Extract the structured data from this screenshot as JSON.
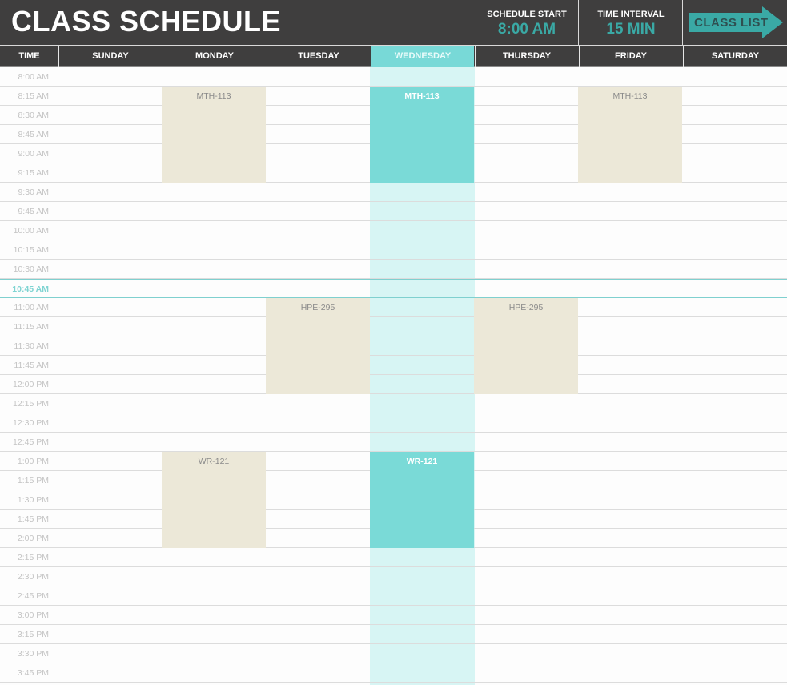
{
  "header": {
    "title": "CLASS SCHEDULE",
    "schedule_start_label": "SCHEDULE START",
    "schedule_start_value": "8:00 AM",
    "time_interval_label": "TIME INTERVAL",
    "time_interval_value": "15 MIN",
    "class_list_button": "CLASS LIST"
  },
  "colors": {
    "header_bg": "#3f3e3e",
    "accent": "#3aa9a5",
    "today_column": "#d7f5f4",
    "today_block": "#7adad7",
    "class_block": "#ece8d8",
    "current_time_line": "#7fd0cf"
  },
  "columns": {
    "time": "TIME",
    "days": [
      "SUNDAY",
      "MONDAY",
      "TUESDAY",
      "WEDNESDAY",
      "THURSDAY",
      "FRIDAY",
      "SATURDAY"
    ],
    "today_index": 3
  },
  "times": [
    "8:00 AM",
    "8:15 AM",
    "8:30 AM",
    "8:45 AM",
    "9:00 AM",
    "9:15 AM",
    "9:30 AM",
    "9:45 AM",
    "10:00 AM",
    "10:15 AM",
    "10:30 AM",
    "10:45 AM",
    "11:00 AM",
    "11:15 AM",
    "11:30 AM",
    "11:45 AM",
    "12:00 PM",
    "12:15 PM",
    "12:30 PM",
    "12:45 PM",
    "1:00 PM",
    "1:15 PM",
    "1:30 PM",
    "1:45 PM",
    "2:00 PM",
    "2:15 PM",
    "2:30 PM",
    "2:45 PM",
    "3:00 PM",
    "3:15 PM",
    "3:30 PM",
    "3:45 PM"
  ],
  "current_time": "10:45 AM",
  "classes": [
    {
      "name": "MTH-113",
      "day": "MONDAY",
      "start": "8:15 AM",
      "slots": 5
    },
    {
      "name": "MTH-113",
      "day": "WEDNESDAY",
      "start": "8:15 AM",
      "slots": 5
    },
    {
      "name": "MTH-113",
      "day": "FRIDAY",
      "start": "8:15 AM",
      "slots": 5
    },
    {
      "name": "HPE-295",
      "day": "TUESDAY",
      "start": "11:00 AM",
      "slots": 5
    },
    {
      "name": "HPE-295",
      "day": "THURSDAY",
      "start": "11:00 AM",
      "slots": 5
    },
    {
      "name": "WR-121",
      "day": "MONDAY",
      "start": "1:00 PM",
      "slots": 5
    },
    {
      "name": "WR-121",
      "day": "WEDNESDAY",
      "start": "1:00 PM",
      "slots": 5
    }
  ]
}
